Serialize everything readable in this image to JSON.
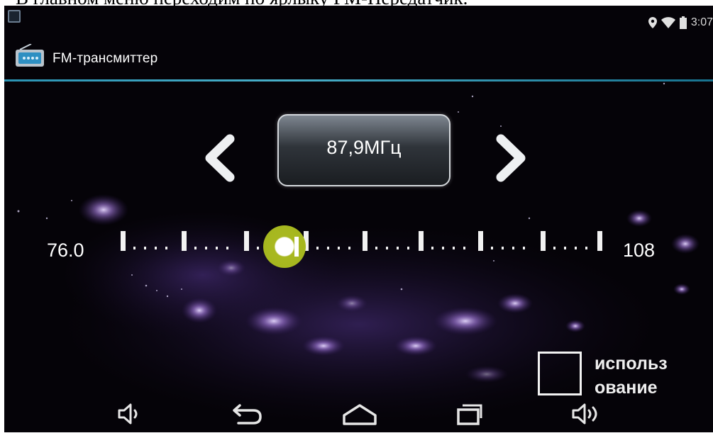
{
  "caption": "В главном меню переходим по ярлыку FM-Передатчик.",
  "status_bar": {
    "time": "3:07",
    "icons": [
      "notification-icon",
      "location-icon",
      "wifi-icon",
      "battery-icon"
    ]
  },
  "action_bar": {
    "title": "FM-трансмиттер",
    "icon": "radio-icon"
  },
  "tuner": {
    "frequency": "87,9МГц",
    "min_label": "76.0",
    "max_label": "108",
    "prev_icon": "chevron-left-icon",
    "next_icon": "chevron-right-icon",
    "current_value": 87.9,
    "range": [
      76.0,
      108
    ]
  },
  "option": {
    "label_line1": "использ",
    "label_line2": "ование",
    "checked": false
  },
  "nav_bar": {
    "buttons": [
      "volume-down-icon",
      "back-icon",
      "home-icon",
      "recent-apps-icon",
      "volume-up-icon"
    ]
  },
  "colors": {
    "accent": "#50c2de",
    "knob": "#a4b61e",
    "background": "#050308"
  }
}
